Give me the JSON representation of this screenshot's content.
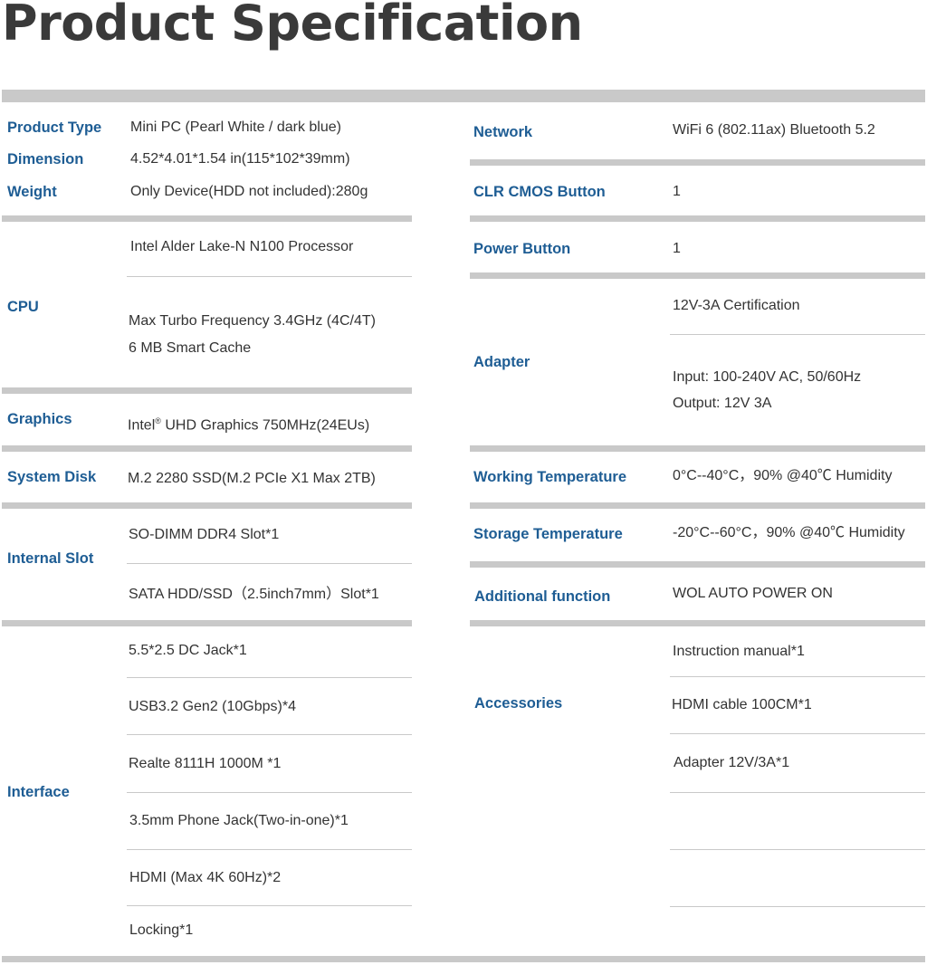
{
  "title": "Product Specification",
  "left": {
    "product_type": {
      "label": "Product Type",
      "value": "Mini PC (Pearl White / dark blue)"
    },
    "dimension": {
      "label": "Dimension",
      "value": "4.52*4.01*1.54 in(115*102*39mm)"
    },
    "weight": {
      "label": "Weight",
      "value": "Only Device(HDD not included):280g"
    },
    "cpu": {
      "label": "CPU",
      "values": [
        "Intel Alder Lake-N N100 Processor",
        "Max Turbo Frequency 3.4GHz  (4C/4T)",
        "6 MB Smart Cache"
      ]
    },
    "graphics": {
      "label": "Graphics",
      "value_prefix": "Intel",
      "value_mark": "®",
      "value_rest": " UHD Graphics 750MHz(24EUs)"
    },
    "system_disk": {
      "label": "System Disk",
      "value": "M.2  2280 SSD(M.2 PCIe X1 Max 2TB)"
    },
    "internal_slot": {
      "label": "Internal Slot",
      "values": [
        "SO-DIMM DDR4 Slot*1",
        "SATA HDD/SSD（2.5inch7mm）Slot*1"
      ]
    },
    "interface": {
      "label": "Interface",
      "values": [
        "5.5*2.5 DC Jack*1",
        "USB3.2 Gen2 (10Gbps)*4",
        "Realte 8111H 1000M *1",
        "3.5mm Phone Jack(Two-in-one)*1",
        "HDMI (Max 4K 60Hz)*2",
        "Locking*1"
      ]
    }
  },
  "right": {
    "network": {
      "label": "Network",
      "value": "WiFi 6 (802.11ax)  Bluetooth 5.2"
    },
    "clr_cmos": {
      "label": "CLR CMOS Button",
      "value": "1"
    },
    "power_button": {
      "label": "Power Button",
      "value": "1"
    },
    "adapter": {
      "label": "Adapter",
      "values": [
        "12V-3A  Certification",
        "Input: 100-240V AC, 50/60Hz",
        "Output: 12V 3A"
      ]
    },
    "working_temp": {
      "label": "Working Temperature",
      "value": "0°C--40°C，90% @40℃ Humidity"
    },
    "storage_temp": {
      "label": "Storage Temperature",
      "value": "-20°C--60°C，90% @40℃ Humidity"
    },
    "additional": {
      "label": "Additional function",
      "value": "WOL   AUTO POWER ON"
    },
    "accessories": {
      "label": "Accessories",
      "values": [
        "Instruction manual*1",
        "HDMI cable 100CM*1",
        "Adapter 12V/3A*1"
      ]
    }
  }
}
